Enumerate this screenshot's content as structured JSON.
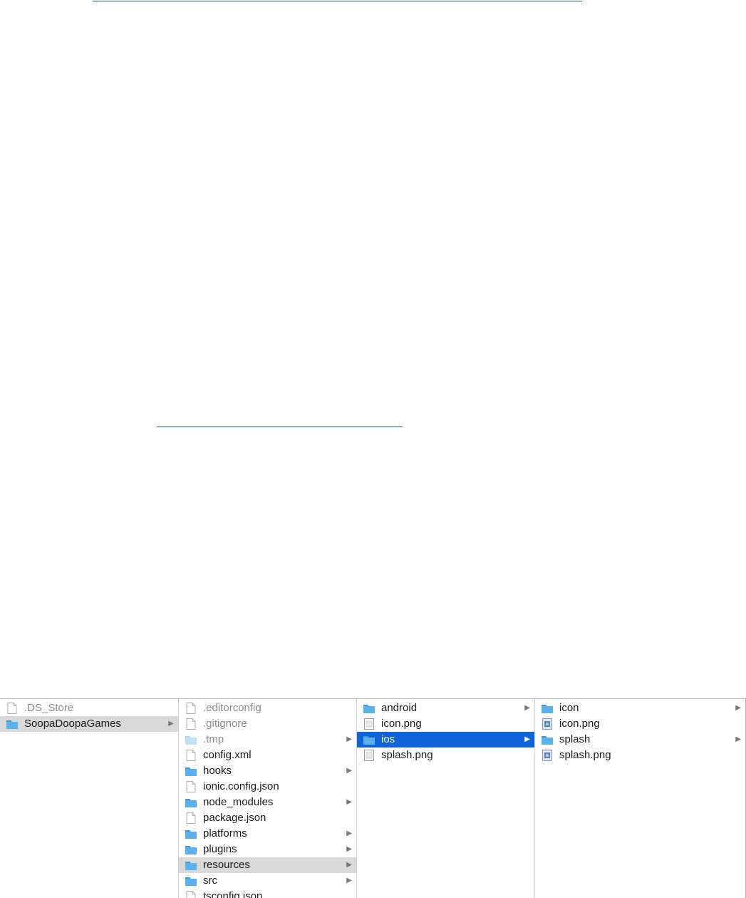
{
  "finder": {
    "columns": [
      {
        "items": [
          {
            "label": ".DS_Store",
            "kind": "file-icon",
            "dim": true,
            "chevron": false,
            "selected": "none"
          },
          {
            "label": "SoopaDoopaGames",
            "kind": "folder-icon",
            "dim": false,
            "chevron": true,
            "selected": "inactive"
          }
        ]
      },
      {
        "items": [
          {
            "label": ".editorconfig",
            "kind": "file-icon",
            "dim": true,
            "chevron": false,
            "selected": "none"
          },
          {
            "label": ".gitignore",
            "kind": "file-icon",
            "dim": true,
            "chevron": false,
            "selected": "none"
          },
          {
            "label": ".tmp",
            "kind": "folder-icon-dim",
            "dim": true,
            "chevron": true,
            "selected": "none"
          },
          {
            "label": "config.xml",
            "kind": "file-icon",
            "dim": false,
            "chevron": false,
            "selected": "none"
          },
          {
            "label": "hooks",
            "kind": "folder-icon",
            "dim": false,
            "chevron": true,
            "selected": "none"
          },
          {
            "label": "ionic.config.json",
            "kind": "file-icon",
            "dim": false,
            "chevron": false,
            "selected": "none"
          },
          {
            "label": "node_modules",
            "kind": "folder-icon",
            "dim": false,
            "chevron": true,
            "selected": "none"
          },
          {
            "label": "package.json",
            "kind": "file-icon",
            "dim": false,
            "chevron": false,
            "selected": "none"
          },
          {
            "label": "platforms",
            "kind": "folder-icon",
            "dim": false,
            "chevron": true,
            "selected": "none"
          },
          {
            "label": "plugins",
            "kind": "folder-icon",
            "dim": false,
            "chevron": true,
            "selected": "none"
          },
          {
            "label": "resources",
            "kind": "folder-icon",
            "dim": false,
            "chevron": true,
            "selected": "inactive"
          },
          {
            "label": "src",
            "kind": "folder-icon",
            "dim": false,
            "chevron": true,
            "selected": "none"
          },
          {
            "label": "tsconfig.json",
            "kind": "file-icon",
            "dim": false,
            "chevron": false,
            "selected": "none"
          }
        ]
      },
      {
        "items": [
          {
            "label": "android",
            "kind": "folder-icon",
            "dim": false,
            "chevron": true,
            "selected": "none"
          },
          {
            "label": "icon.png",
            "kind": "image-file-icon",
            "dim": false,
            "chevron": false,
            "selected": "none"
          },
          {
            "label": "ios",
            "kind": "folder-icon",
            "dim": false,
            "chevron": true,
            "selected": "active"
          },
          {
            "label": "splash.png",
            "kind": "image-file-icon",
            "dim": false,
            "chevron": false,
            "selected": "none"
          }
        ]
      },
      {
        "items": [
          {
            "label": "icon",
            "kind": "folder-icon",
            "dim": false,
            "chevron": true,
            "selected": "none"
          },
          {
            "label": "icon.png",
            "kind": "image-thumb-icon",
            "dim": false,
            "chevron": false,
            "selected": "none"
          },
          {
            "label": "splash",
            "kind": "folder-icon",
            "dim": false,
            "chevron": true,
            "selected": "none"
          },
          {
            "label": "splash.png",
            "kind": "image-thumb-icon",
            "dim": false,
            "chevron": false,
            "selected": "none"
          }
        ]
      }
    ],
    "chevron_glyph": "▶"
  },
  "colors": {
    "folder": "#5bb2ea",
    "folder_dim": "#bfe0f5",
    "selection_active": "#0f63d6",
    "selection_inactive": "#d9d9d9",
    "underline": "#2a4a7a"
  }
}
